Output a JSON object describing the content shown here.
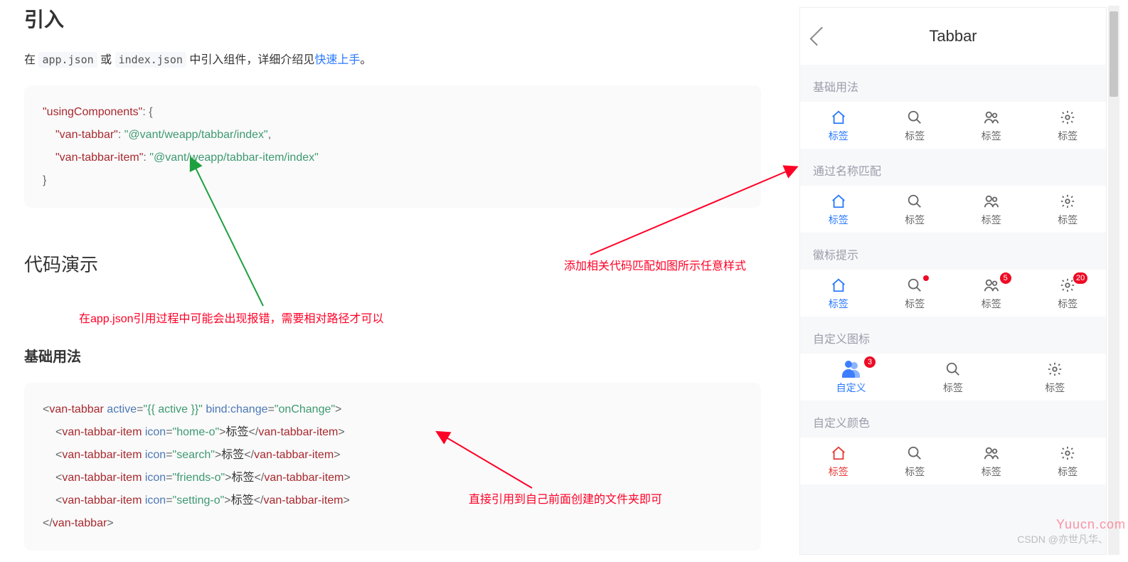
{
  "docs": {
    "h1": "引入",
    "intro_prefix": "在 ",
    "code1": "app.json",
    "intro_mid1": " 或 ",
    "code2": "index.json",
    "intro_mid2": " 中引入组件，详细介绍见",
    "link": "快速上手",
    "intro_suffix": "。",
    "json_code": {
      "using": "\"usingComponents\"",
      "key1": "\"van-tabbar\"",
      "val1": "\"@vant/weapp/tabbar/index\"",
      "key2": "\"van-tabbar-item\"",
      "val2": "\"@vant/weapp/tabbar-item/index\""
    },
    "h2": "代码演示",
    "h3": "基础用法",
    "wxml": {
      "open": "van-tabbar",
      "attr1n": "active",
      "attr1v": "\"{{ active }}\"",
      "attr2n": "bind:change",
      "attr2v": "\"onChange\"",
      "itemtag": "van-tabbar-item",
      "iconattr": "icon",
      "icons": [
        "\"home-o\"",
        "\"search\"",
        "\"friends-o\"",
        "\"setting-o\""
      ],
      "label": "标签"
    },
    "anno_red1": "添加相关代码匹配如图所示任意样式",
    "anno_red2": "在app.json引用过程中可能会出现报错，需要相对路径才可以",
    "anno_red3": "直接引用到自己前面创建的文件夹即可"
  },
  "preview": {
    "title": "Tabbar",
    "sec1": "基础用法",
    "sec2": "通过名称匹配",
    "sec3": "徽标提示",
    "sec4": "自定义图标",
    "sec5": "自定义颜色",
    "tab_label": "标签",
    "custom_label": "自定义",
    "badge5": "5",
    "badge20": "20",
    "badge3": "3"
  },
  "watermark1": "Yuucn.com",
  "watermark2": "CSDN @亦世凡华、"
}
